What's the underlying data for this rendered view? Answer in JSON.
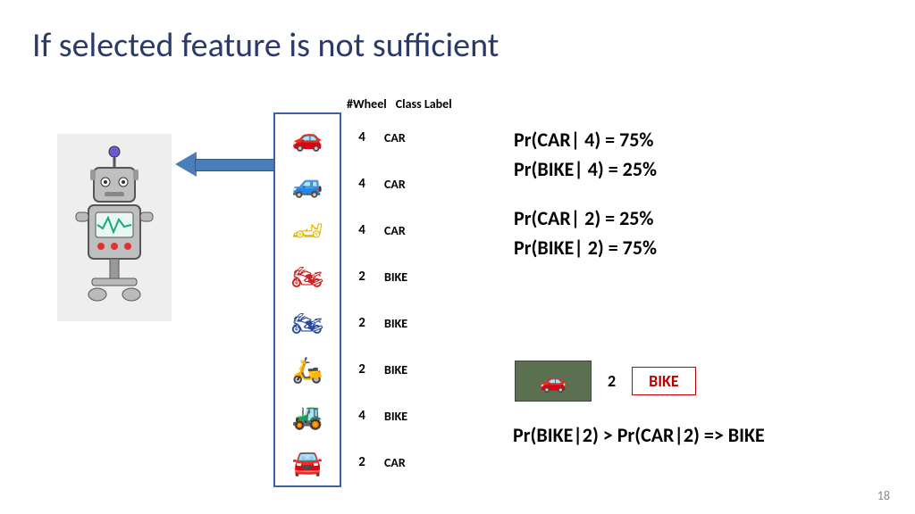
{
  "title": "If selected feature is not sufficient",
  "columns": {
    "wheel": "#Wheel",
    "label": "Class Label"
  },
  "rows": [
    {
      "wheel": "4",
      "label": "CAR",
      "glyph": "🚗",
      "cls": "car-red"
    },
    {
      "wheel": "4",
      "label": "CAR",
      "glyph": "🚙",
      "cls": "car-blue"
    },
    {
      "wheel": "4",
      "label": "CAR",
      "glyph": "🏎",
      "cls": "car-yellow"
    },
    {
      "wheel": "2",
      "label": "BIKE",
      "glyph": "🏍",
      "cls": "bike-red"
    },
    {
      "wheel": "2",
      "label": "BIKE",
      "glyph": "🏍",
      "cls": "bike-blue"
    },
    {
      "wheel": "2",
      "label": "BIKE",
      "glyph": "🛵",
      "cls": "bike-yellow"
    },
    {
      "wheel": "4",
      "label": "BIKE",
      "glyph": "🚜",
      "cls": "quad-red"
    },
    {
      "wheel": "2",
      "label": "CAR",
      "glyph": "🚘",
      "cls": "car-white"
    }
  ],
  "probs": {
    "p1": "Pr(CAR| 4) = 75%",
    "p2": "Pr(BIKE| 4) = 25%",
    "p3": "Pr(CAR| 2) =  25%",
    "p4": "Pr(BIKE| 2) = 75%"
  },
  "test": {
    "wheel": "2",
    "label": "BIKE"
  },
  "conclusion": "Pr(BIKE|2) > Pr(CAR|2) => BIKE",
  "slide_number": "18"
}
